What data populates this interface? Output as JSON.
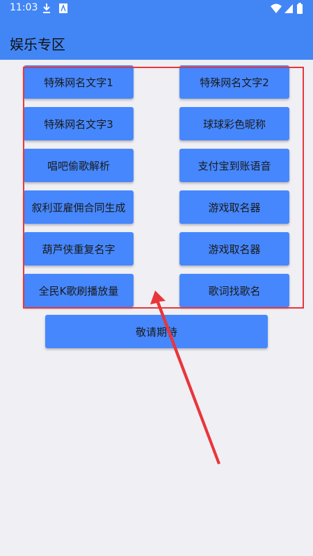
{
  "status": {
    "time": "11:03"
  },
  "app": {
    "title": "娱乐专区"
  },
  "buttons": {
    "left": [
      "特殊网名文字1",
      "特殊网名文字3",
      "唱吧偷歌解析",
      "叙利亚雇佣合同生成",
      "葫芦侠重复名字",
      "全民K歌刷播放量"
    ],
    "right": [
      "特殊网名文字2",
      "球球彩色昵称",
      "支付宝到账语音",
      "游戏取名器",
      "游戏取名器",
      "歌词找歌名"
    ],
    "bottom": "敬请期待"
  },
  "colors": {
    "primary": "#4286f5",
    "button": "#4687fd",
    "highlight": "#e8363b",
    "background": "#f0eff4"
  }
}
